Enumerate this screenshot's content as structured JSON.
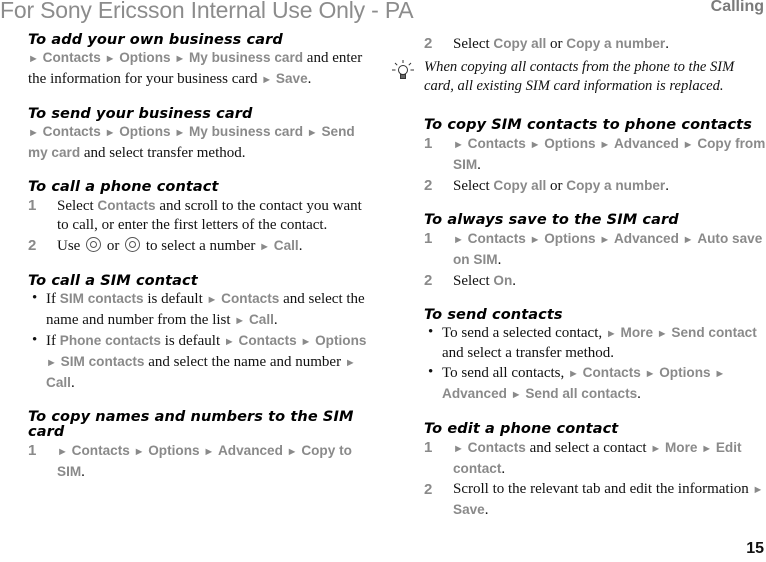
{
  "header": {
    "watermark": "For Sony Ericsson Internal Use Only - PA",
    "running_head": "Calling"
  },
  "footer": {
    "page_number": "15"
  },
  "arrow": "►",
  "left_column": {
    "add_business_card": {
      "title": "To add your own business card",
      "m1": "Contacts",
      "m2": "Options",
      "m3": "My business card",
      "t1": " and enter the information for your business card ",
      "m4": "Save",
      "t2": "."
    },
    "send_business_card": {
      "title": "To send your business card",
      "m1": "Contacts",
      "m2": "Options",
      "m3": "My business card",
      "m4": "Send my card",
      "t1": " and select transfer method."
    },
    "call_phone_contact": {
      "title": "To call a phone contact",
      "step1": {
        "num": "1",
        "t1": "Select ",
        "m1": "Contacts",
        "t2": " and scroll to the contact you want to call, or enter the first letters of the contact."
      },
      "step2": {
        "num": "2",
        "t1": "Use ",
        "icon1": "nav-left-key-icon",
        "t2": " or ",
        "icon2": "nav-right-key-icon",
        "t3": " to select a number ",
        "m1": "Call",
        "t4": "."
      }
    },
    "call_sim_contact": {
      "title": "To call a SIM contact",
      "bullet": "•",
      "b1": {
        "t1": "If ",
        "m1": "SIM contacts",
        "t2": " is default ",
        "m2": "Contacts",
        "t3": " and select the name and number from the list ",
        "m3": "Call",
        "t4": "."
      },
      "b2": {
        "t1": "If ",
        "m1": "Phone contacts",
        "t2": " is default ",
        "m2": "Contacts",
        "m3": "Options",
        "m4": "SIM contacts",
        "t3": " and select the name and number ",
        "m5": "Call",
        "t4": "."
      }
    },
    "copy_to_sim": {
      "title": "To copy names and numbers to the SIM card",
      "step1": {
        "num": "1",
        "m1": "Contacts",
        "m2": "Options",
        "m3": "Advanced",
        "m4": "Copy to SIM",
        "t1": "."
      }
    }
  },
  "right_column": {
    "copy_to_sim_cont": {
      "step2": {
        "num": "2",
        "t1": "Select ",
        "m1": "Copy all",
        "t2": " or ",
        "m2": "Copy a number",
        "t3": "."
      },
      "tip": {
        "icon": "lightbulb-tip-icon",
        "text": "When copying all contacts from the phone to the SIM card, all existing SIM card information is replaced."
      }
    },
    "copy_sim_to_phone": {
      "title": "To copy SIM contacts to phone contacts",
      "step1": {
        "num": "1",
        "m1": "Contacts",
        "m2": "Options",
        "m3": "Advanced",
        "m4": "Copy from SIM",
        "t1": "."
      },
      "step2": {
        "num": "2",
        "t1": "Select ",
        "m1": "Copy all",
        "t2": " or ",
        "m2": "Copy a number",
        "t3": "."
      }
    },
    "always_save_sim": {
      "title": "To always save to the SIM card",
      "step1": {
        "num": "1",
        "m1": "Contacts",
        "m2": "Options",
        "m3": "Advanced",
        "m4": "Auto save on SIM",
        "t1": "."
      },
      "step2": {
        "num": "2",
        "t1": "Select ",
        "m1": "On",
        "t2": "."
      }
    },
    "send_contacts": {
      "title": "To send contacts",
      "bullet": "•",
      "b1": {
        "t1": "To send a selected contact, ",
        "m1": "More",
        "m2": "Send contact",
        "t2": " and select a transfer method."
      },
      "b2": {
        "t1": "To send all contacts, ",
        "m1": "Contacts",
        "m2": "Options",
        "m3": "Advanced",
        "m4": "Send all contacts",
        "t2": "."
      }
    },
    "edit_phone_contact": {
      "title": "To edit a phone contact",
      "step1": {
        "num": "1",
        "m1": "Contacts",
        "t1": " and select a contact ",
        "m2": "More",
        "m3": "Edit contact",
        "t2": "."
      },
      "step2": {
        "num": "2",
        "t1": "Scroll to the relevant tab and edit the information ",
        "m1": "Save",
        "t2": "."
      }
    }
  }
}
